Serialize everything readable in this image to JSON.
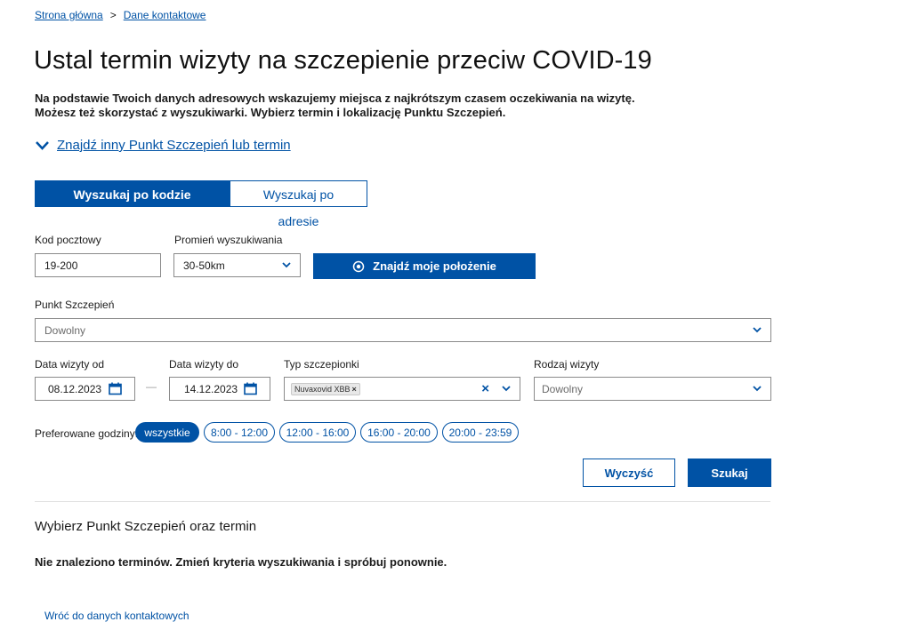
{
  "breadcrumb": {
    "home": "Strona główna",
    "separator": ">",
    "current": "Dane kontaktowe"
  },
  "page": {
    "title": "Ustal termin wizyty na szczepienie przeciw COVID-19",
    "lead_line1": "Na podstawie Twoich danych adresowych wskazujemy miejsca z najkrótszym czasem oczekiwania na wizytę.",
    "lead_line2": "Możesz też skorzystać z wyszukiwarki. Wybierz termin i lokalizację Punktu Szczepień.",
    "toggle_label": "Znajdź inny Punkt Szczepień lub termin"
  },
  "tabs": [
    {
      "label": "Wyszukaj po kodzie pocztowym",
      "active": true
    },
    {
      "label": "Wyszukaj po adresie",
      "active": false
    }
  ],
  "form": {
    "postal_code": {
      "label": "Kod pocztowy",
      "value": "19-200"
    },
    "radius": {
      "label": "Promień wyszukiwania",
      "value": "30-50km"
    },
    "locate_button": "Znajdź moje położenie",
    "point": {
      "label": "Punkt Szczepień",
      "placeholder": "Dowolny"
    },
    "date_from": {
      "label": "Data wizyty od",
      "value": "08.12.2023"
    },
    "date_sep": "—",
    "date_to": {
      "label": "Data wizyty do",
      "value": "14.12.2023"
    },
    "vaccine_type": {
      "label": "Typ szczepionki",
      "tag": "Nuvaxovid XBB",
      "tag_remove": "×",
      "clear": "×"
    },
    "visit_type": {
      "label": "Rodzaj wizyty",
      "placeholder": "Dowolny"
    },
    "hours": {
      "label": "Preferowane godziny:",
      "options": [
        "wszystkie",
        "8:00 - 12:00",
        "12:00 - 16:00",
        "16:00 - 20:00",
        "20:00 - 23:59"
      ],
      "selected": "wszystkie"
    },
    "clear_button": "Wyczyść",
    "search_button": "Szukaj"
  },
  "results": {
    "title": "Wybierz Punkt Szczepień oraz termin",
    "empty_message": "Nie znaleziono terminów. Zmień kryteria wyszukiwania i spróbuj ponownie.",
    "partial_link": "Wróć do danych kontaktowych"
  },
  "icons": {
    "toggle": "chevron-down-icon",
    "locate": "target-icon",
    "calendar": "calendar-icon",
    "select": "chevron-down-icon"
  },
  "colors": {
    "primary": "#0052a5",
    "text": "#1b1b1b",
    "border": "#8a8a8a"
  }
}
